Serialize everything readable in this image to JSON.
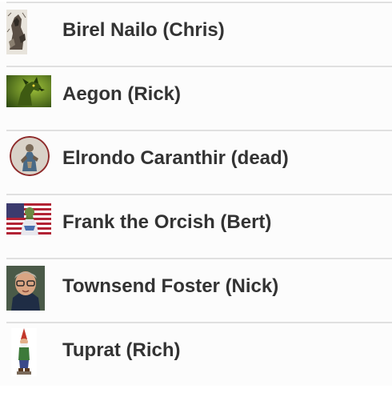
{
  "characters": [
    {
      "name": "Birel Nailo (Chris)",
      "avatar": "sketched-warrior-portrait"
    },
    {
      "name": "Aegon (Rick)",
      "avatar": "green-dragon-portrait"
    },
    {
      "name": "Elrondo Caranthir (dead)",
      "avatar": "armored-knight-round-portrait"
    },
    {
      "name": "Frank the Orcish (Bert)",
      "avatar": "orc-with-flag-portrait"
    },
    {
      "name": "Townsend Foster (Nick)",
      "avatar": "man-with-glasses-portrait"
    },
    {
      "name": "Tuprat (Rich)",
      "avatar": "garden-gnome-portrait"
    }
  ]
}
